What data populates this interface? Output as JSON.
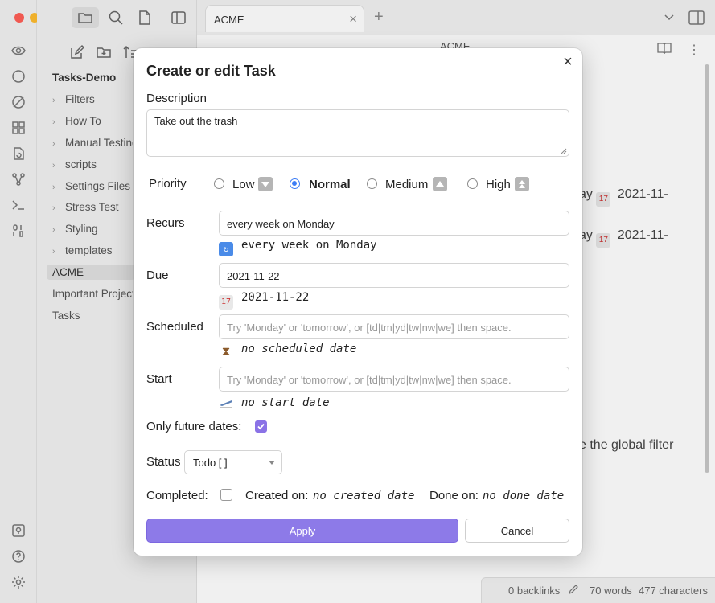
{
  "window": {
    "tab_title": "ACME",
    "tab_close": "×",
    "tab_add": "+",
    "header_title": "ACME"
  },
  "sidebar": {
    "vault_name": "Tasks-Demo",
    "folders": [
      {
        "label": "Filters"
      },
      {
        "label": "How To"
      },
      {
        "label": "Manual Testing"
      },
      {
        "label": "scripts"
      },
      {
        "label": "Settings Files"
      },
      {
        "label": "Stress Test"
      },
      {
        "label": "Styling"
      },
      {
        "label": "templates"
      }
    ],
    "files": [
      {
        "label": "ACME",
        "selected": true
      },
      {
        "label": "Important Projects"
      },
      {
        "label": "Tasks"
      }
    ]
  },
  "background": {
    "line1_suffix": "ay",
    "line1_date": "2021-11-",
    "line2_suffix": "ay",
    "line2_date": "2021-11-",
    "global_filter_text": "e the global filter"
  },
  "statusbar": {
    "backlinks": "0 backlinks",
    "words": "70 words",
    "characters": "477 characters"
  },
  "modal": {
    "title": "Create or edit Task",
    "close": "×",
    "description_label": "Description",
    "description_value": "Take out the trash",
    "priority_label": "Priority",
    "priorities": [
      {
        "label": "Low",
        "checked": false
      },
      {
        "label": "Normal",
        "checked": true
      },
      {
        "label": "Medium",
        "checked": false
      },
      {
        "label": "High",
        "checked": false
      }
    ],
    "recurs_label": "Recurs",
    "recurs_value": "every week on Monday",
    "recurs_preview": "every week on Monday",
    "due_label": "Due",
    "due_value": "2021-11-22",
    "due_preview": "2021-11-22",
    "scheduled_label": "Scheduled",
    "scheduled_placeholder": "Try 'Monday' or 'tomorrow', or [td|tm|yd|tw|nw|we] then space.",
    "scheduled_preview": "no scheduled date",
    "start_label": "Start",
    "start_placeholder": "Try 'Monday' or 'tomorrow', or [td|tm|yd|tw|nw|we] then space.",
    "start_preview": "no start date",
    "only_future_label": "Only future dates:",
    "only_future_checked": true,
    "status_label": "Status",
    "status_value": "Todo [ ]",
    "completed_label": "Completed:",
    "created_label": "Created on:",
    "created_value": "no created date",
    "done_label": "Done on:",
    "done_value": "no done date",
    "apply_label": "Apply",
    "cancel_label": "Cancel"
  },
  "colors": {
    "accent": "#8d7ae8",
    "radio_checked": "#3b7cf5"
  }
}
